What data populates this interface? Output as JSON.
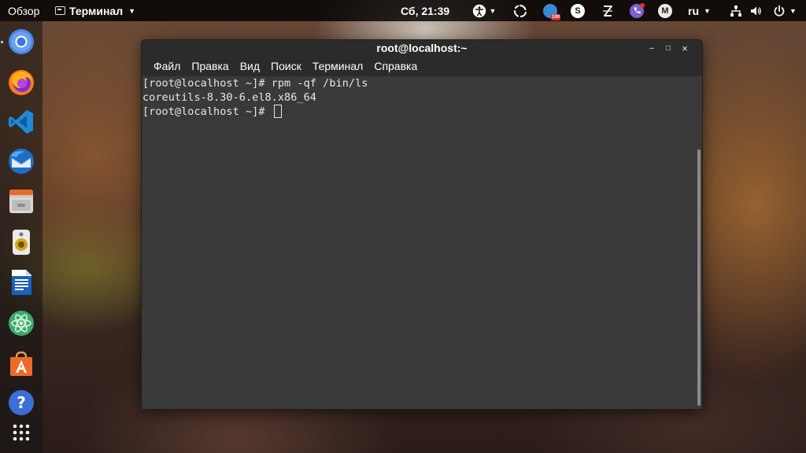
{
  "topbar": {
    "activities_label": "Обзор",
    "app_menu_label": "Терминал",
    "clock": "Сб, 21:39",
    "tray": {
      "notification_badge": "100",
      "skype_letter": "S",
      "mail_letter": "M"
    },
    "language": "ru"
  },
  "dock": {
    "items": [
      "chromium-icon",
      "firefox-icon",
      "vscode-icon",
      "thunderbird-icon",
      "files-icon",
      "rhythmbox-icon",
      "libreoffice-writer-icon",
      "atom-icon",
      "software-center-icon",
      "help-icon",
      "show-apps-icon"
    ]
  },
  "window": {
    "title": "root@localhost:~",
    "controls": {
      "minimize": "‒",
      "maximize": "□",
      "close": "×"
    },
    "menu": [
      "Файл",
      "Правка",
      "Вид",
      "Поиск",
      "Терминал",
      "Справка"
    ],
    "terminal_lines": [
      "[root@localhost ~]# rpm -qf /bin/ls",
      "coreutils-8.30-6.el8.x86_64",
      "[root@localhost ~]# "
    ]
  },
  "colors": {
    "topbar_bg": "#000000",
    "terminal_bg": "#393939",
    "titlebar_bg": "#2b2b2b",
    "terminal_fg": "#e6e6e6"
  }
}
